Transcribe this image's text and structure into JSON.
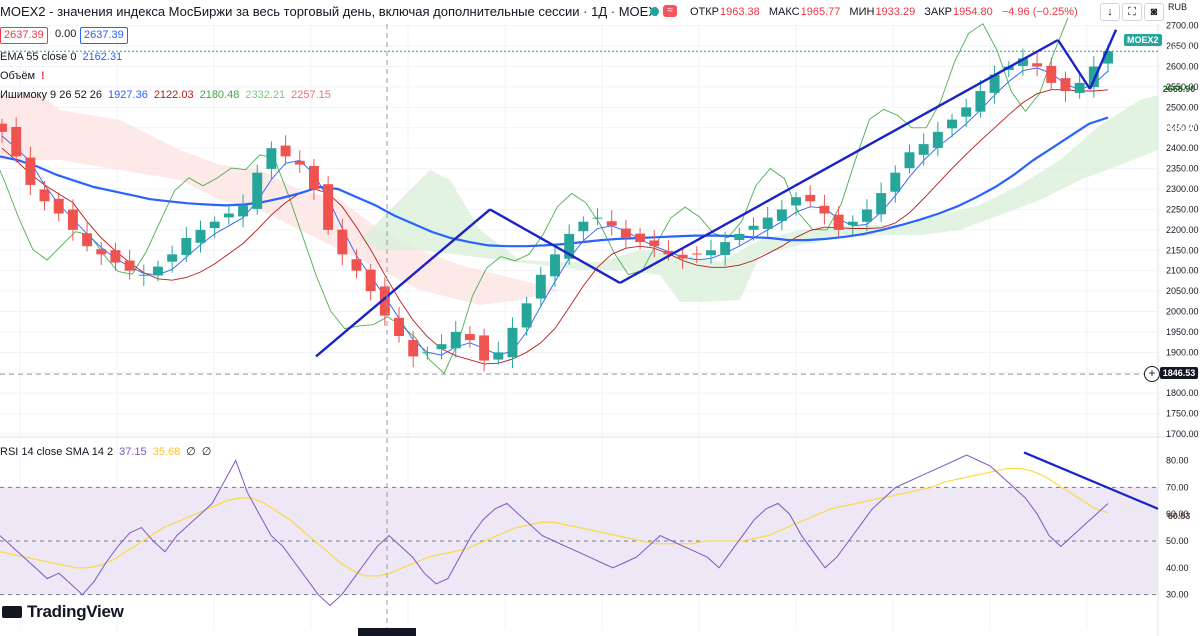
{
  "header": {
    "title": "MOEX2 - значения индекса МосБиржи за весь торговый день, включая дополнительные сессии · 1Д · MOEX",
    "o_label": "ОТКР",
    "o_value": "1963.38",
    "h_label": "МАКС",
    "h_value": "1965.77",
    "l_label": "МИН",
    "l_value": "1933.29",
    "c_label": "ЗАКР",
    "c_value": "1954.80",
    "change": "−4.96 (−0.25%)",
    "currency": "RUB",
    "icons": [
      "arrow-down-icon",
      "fullscreen-icon",
      "camera-icon"
    ]
  },
  "price_boxes": {
    "sell": "2637.39",
    "spread": "0.00",
    "buy": "2637.39"
  },
  "legend": {
    "ema_label": "EMA 55 close 0",
    "ema_value": "2162.31",
    "volume_label": "Объём",
    "ichimoku_label": "Ишимоку 9 26 52 26",
    "ichimoku_values": [
      "1927.36",
      "2122.03",
      "2180.48",
      "2332.21",
      "2257.15"
    ],
    "rsi_label": "RSI 14 close SMA 14 2",
    "rsi_values": [
      "37.15",
      "35.68",
      "∅",
      "∅"
    ]
  },
  "price_axis": {
    "ticks": [
      "2700.00",
      "2650.00",
      "2600.00",
      "2550.00",
      "2500.00",
      "2450.00",
      "2400.00",
      "2350.00",
      "2300.00",
      "2250.00",
      "2200.00",
      "2150.00",
      "2100.00",
      "2050.00",
      "2000.00",
      "1950.00",
      "1900.00",
      "1850.00",
      "1800.00",
      "1750.00",
      "1700.00"
    ],
    "labels": [
      {
        "text": "2637.39",
        "color": "#26a69a"
      },
      {
        "text": "2637.39",
        "color": "#26a69a"
      },
      {
        "text": "2570.85",
        "color": "#f23645"
      },
      {
        "text": "2565.90",
        "color": "#a5d6a7"
      },
      {
        "text": "2560.95",
        "color": "#2962ff"
      },
      {
        "text": "2474.84",
        "color": "#2962ff"
      },
      {
        "text": "2446.67",
        "color": "#ef9a9a"
      }
    ],
    "symbol_tag": "MOEX2",
    "crosshair_value": "1846.53"
  },
  "rsi_axis": {
    "ticks": [
      "80.00",
      "70.00",
      "60.00",
      "50.00",
      "40.00",
      "30.00"
    ],
    "labels": [
      {
        "text": "63.98",
        "color": "#7e57c2"
      },
      {
        "text": "60.53",
        "color": "#fdd835"
      }
    ]
  },
  "logo": "TradingView",
  "colors": {
    "up": "#26a69a",
    "down": "#ef5350",
    "ema": "#2962ff",
    "trend": "#1a22c8",
    "rsi": "#7e57c2",
    "rsi_sma": "#fdd835",
    "rsi_band": "#ede7f6"
  },
  "chart_data": [
    {
      "type": "candlestick",
      "title": "MOEX2 · 1Д · MOEX",
      "ylim": [
        1700,
        2700
      ],
      "series": [
        {
          "name": "MOEX2",
          "values": [
            2440,
            2380,
            2310,
            2270,
            2240,
            2200,
            2160,
            2140,
            2120,
            2100,
            2090,
            2110,
            2140,
            2180,
            2200,
            2220,
            2240,
            2260,
            2340,
            2400,
            2380,
            2360,
            2300,
            2200,
            2140,
            2100,
            2050,
            1990,
            1940,
            1890,
            1900,
            1920,
            1950,
            1930,
            1880,
            1900,
            1960,
            2020,
            2090,
            2140,
            2190,
            2220,
            2230,
            2210,
            2180,
            2170,
            2160,
            2140,
            2130,
            2140,
            2150,
            2170,
            2190,
            2210,
            2230,
            2250,
            2280,
            2270,
            2240,
            2200,
            2220,
            2250,
            2290,
            2340,
            2390,
            2410,
            2440,
            2470,
            2500,
            2540,
            2580,
            2600,
            2620,
            2600,
            2560,
            2540,
            2560,
            2600,
            2637.39
          ]
        },
        {
          "name": "EMA 55 close 0",
          "values": [
            2380,
            2370,
            2355,
            2335,
            2320,
            2305,
            2295,
            2285,
            2275,
            2270,
            2265,
            2262,
            2260,
            2262,
            2268,
            2278,
            2290,
            2305,
            2300,
            2280,
            2260,
            2235,
            2215,
            2195,
            2180,
            2170,
            2162,
            2160,
            2160,
            2162,
            2165,
            2170,
            2175,
            2178,
            2180,
            2182,
            2184,
            2186,
            2186,
            2185,
            2182,
            2180,
            2175,
            2175,
            2178,
            2183,
            2190,
            2200,
            2212,
            2225,
            2240,
            2258,
            2280,
            2305,
            2335,
            2370,
            2400,
            2430,
            2460,
            2474.84
          ]
        },
        {
          "name": "Ишимоку 9 26 52 26",
          "values": [
            1927.36,
            2122.03,
            2180.48,
            2332.21,
            2257.15
          ]
        }
      ],
      "trendlines": [
        {
          "from": [
            0,
            1890
          ],
          "to": [
            1,
            2250
          ]
        },
        {
          "from": [
            1,
            2250
          ],
          "to": [
            2,
            2070
          ]
        },
        {
          "from": [
            2,
            2070
          ],
          "to": [
            3,
            2665
          ]
        },
        {
          "from": [
            3,
            2665
          ],
          "to": [
            4,
            2545
          ]
        },
        {
          "from": [
            4,
            2545
          ],
          "to": [
            5,
            2690
          ]
        }
      ]
    },
    {
      "type": "line",
      "title": "RSI 14 close SMA 14 2",
      "ylim": [
        25,
        87
      ],
      "series": [
        {
          "name": "RSI",
          "values": [
            52,
            48,
            44,
            40,
            36,
            38,
            34,
            30,
            35,
            42,
            48,
            53,
            55,
            50,
            46,
            52,
            56,
            60,
            64,
            72,
            80,
            68,
            60,
            52,
            48,
            42,
            36,
            30,
            26,
            30,
            36,
            42,
            48,
            52,
            48,
            44,
            38,
            34,
            36,
            44,
            52,
            58,
            62,
            64,
            60,
            56,
            52,
            50,
            48,
            46,
            44,
            42,
            40,
            42,
            44,
            48,
            52,
            50,
            48,
            46,
            44,
            40,
            46,
            52,
            58,
            62,
            64,
            60,
            52,
            46,
            40,
            44,
            50,
            56,
            62,
            66,
            70,
            72,
            74,
            76,
            78,
            80,
            82,
            80,
            78,
            74,
            70,
            66,
            60,
            52,
            48,
            52,
            56,
            60,
            63.98
          ]
        },
        {
          "name": "SMA",
          "values": [
            46,
            45,
            44,
            43,
            42,
            41,
            40,
            40,
            41,
            43,
            46,
            49,
            52,
            55,
            57,
            59,
            61,
            63,
            65,
            66,
            66,
            64,
            61,
            58,
            54,
            50,
            46,
            42,
            39,
            37,
            37,
            38,
            40,
            42,
            44,
            45,
            46,
            47,
            49,
            51,
            53,
            55,
            56,
            57,
            57,
            56,
            55,
            54,
            53,
            52,
            51,
            50,
            49,
            49,
            49,
            49,
            50,
            50,
            50,
            50,
            51,
            52,
            54,
            56,
            58,
            60,
            62,
            63,
            64,
            65,
            66,
            67,
            68,
            69,
            70,
            72,
            73,
            74,
            75,
            76,
            77,
            77,
            76,
            74,
            71,
            68,
            65,
            62,
            60.53
          ]
        }
      ],
      "trendlines": [
        {
          "from": [
            0,
            83
          ],
          "to": [
            1,
            62
          ]
        }
      ]
    }
  ]
}
